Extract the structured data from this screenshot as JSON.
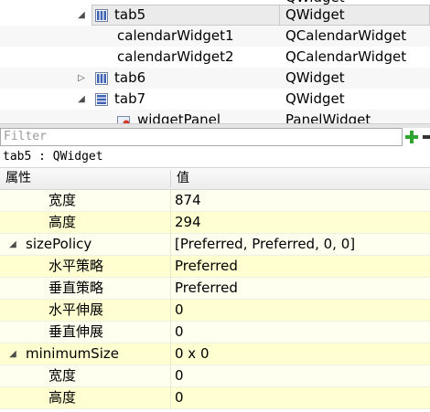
{
  "tree": {
    "rows": [
      {
        "name": "",
        "class": "QWidget",
        "expander": "",
        "icon": ""
      },
      {
        "name": "tab5",
        "class": "QWidget",
        "expander": "expanded",
        "icon": "columns-layout-icon"
      },
      {
        "name": "calendarWidget1",
        "class": "QCalendarWidget",
        "expander": "",
        "icon": ""
      },
      {
        "name": "calendarWidget2",
        "class": "QCalendarWidget",
        "expander": "",
        "icon": ""
      },
      {
        "name": "tab6",
        "class": "QWidget",
        "expander": "collapsed",
        "icon": "columns-layout-icon"
      },
      {
        "name": "tab7",
        "class": "QWidget",
        "expander": "expanded",
        "icon": "rows-layout-icon"
      },
      {
        "name": "widgetPanel",
        "class": "PanelWidget",
        "expander": "",
        "icon": "widget-icon"
      }
    ]
  },
  "editor": {
    "filter_placeholder": "Filter",
    "object_label": "tab5 : QWidget",
    "header_property": "属性",
    "header_value": "值",
    "properties": [
      {
        "name": "宽度",
        "value": "874",
        "kind": "sub"
      },
      {
        "name": "高度",
        "value": "294",
        "kind": "sub"
      },
      {
        "name": "sizePolicy",
        "value": "[Preferred, Preferred, 0, 0]",
        "kind": "group"
      },
      {
        "name": "水平策略",
        "value": "Preferred",
        "kind": "sub"
      },
      {
        "name": "垂直策略",
        "value": "Preferred",
        "kind": "sub"
      },
      {
        "name": "水平伸展",
        "value": "0",
        "kind": "sub"
      },
      {
        "name": "垂直伸展",
        "value": "0",
        "kind": "sub"
      },
      {
        "name": "minimumSize",
        "value": "0 x 0",
        "kind": "group"
      },
      {
        "name": "宽度",
        "value": "0",
        "kind": "sub"
      },
      {
        "name": "高度",
        "value": "0",
        "kind": "sub"
      }
    ]
  },
  "colors": {
    "row_light": "#fffff0",
    "row_dark": "#ffffd1",
    "add_green": "#2fa52f"
  }
}
